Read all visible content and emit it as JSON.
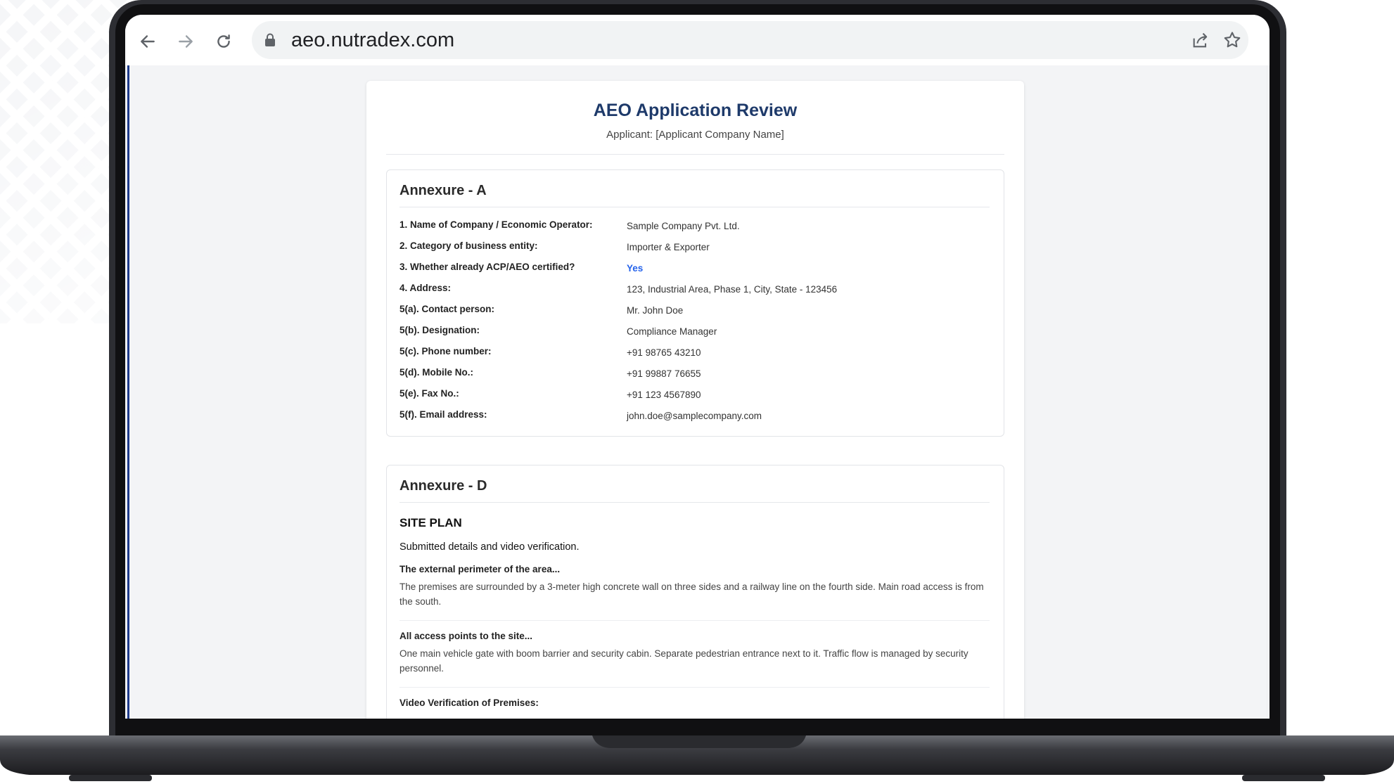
{
  "browser": {
    "url": "aeo.nutradex.com",
    "icons": [
      "back-arrow-icon",
      "forward-arrow-icon",
      "reload-icon",
      "lock-icon",
      "share-icon",
      "star-icon"
    ]
  },
  "header": {
    "title": "AEO Application Review",
    "subtitle": "Applicant: [Applicant Company Name]"
  },
  "annexure_a": {
    "title": "Annexure - A",
    "rows": [
      {
        "label": "1. Name of Company / Economic Operator:",
        "value": "Sample Company Pvt. Ltd."
      },
      {
        "label": "2. Category of business entity:",
        "value": "Importer & Exporter"
      },
      {
        "label": "3. Whether already ACP/AEO certified?",
        "value": "Yes"
      },
      {
        "label": "4. Address:",
        "value": "123, Industrial Area, Phase 1, City, State - 123456"
      },
      {
        "label": "5(a). Contact person:",
        "value": "Mr. John Doe"
      },
      {
        "label": "5(b). Designation:",
        "value": "Compliance Manager"
      },
      {
        "label": "5(c). Phone number:",
        "value": "+91 98765 43210"
      },
      {
        "label": "5(d). Mobile No.:",
        "value": "+91 99887 76655"
      },
      {
        "label": "5(e). Fax No.:",
        "value": "+91 123 4567890"
      },
      {
        "label": "5(f). Email address:",
        "value": "john.doe@samplecompany.com"
      }
    ]
  },
  "annexure_d": {
    "title": "Annexure - D",
    "site_plan_title": "SITE PLAN",
    "intro": "Submitted details and video verification.",
    "questions": [
      {
        "q": "The external perimeter of the area...",
        "a": "The premises are surrounded by a 3-meter high concrete wall on three sides and a railway line on the fourth side. Main road access is from the south."
      },
      {
        "q": "All access points to the site...",
        "a": "One main vehicle gate with boom barrier and security cabin. Separate pedestrian entrance next to it. Traffic flow is managed by security personnel."
      },
      {
        "q": "Video Verification of Premises:",
        "a": ""
      }
    ]
  },
  "colors": {
    "title": "#1e3a6a",
    "yes": "#2563eb",
    "accent_strip": "#1e3a8a"
  }
}
